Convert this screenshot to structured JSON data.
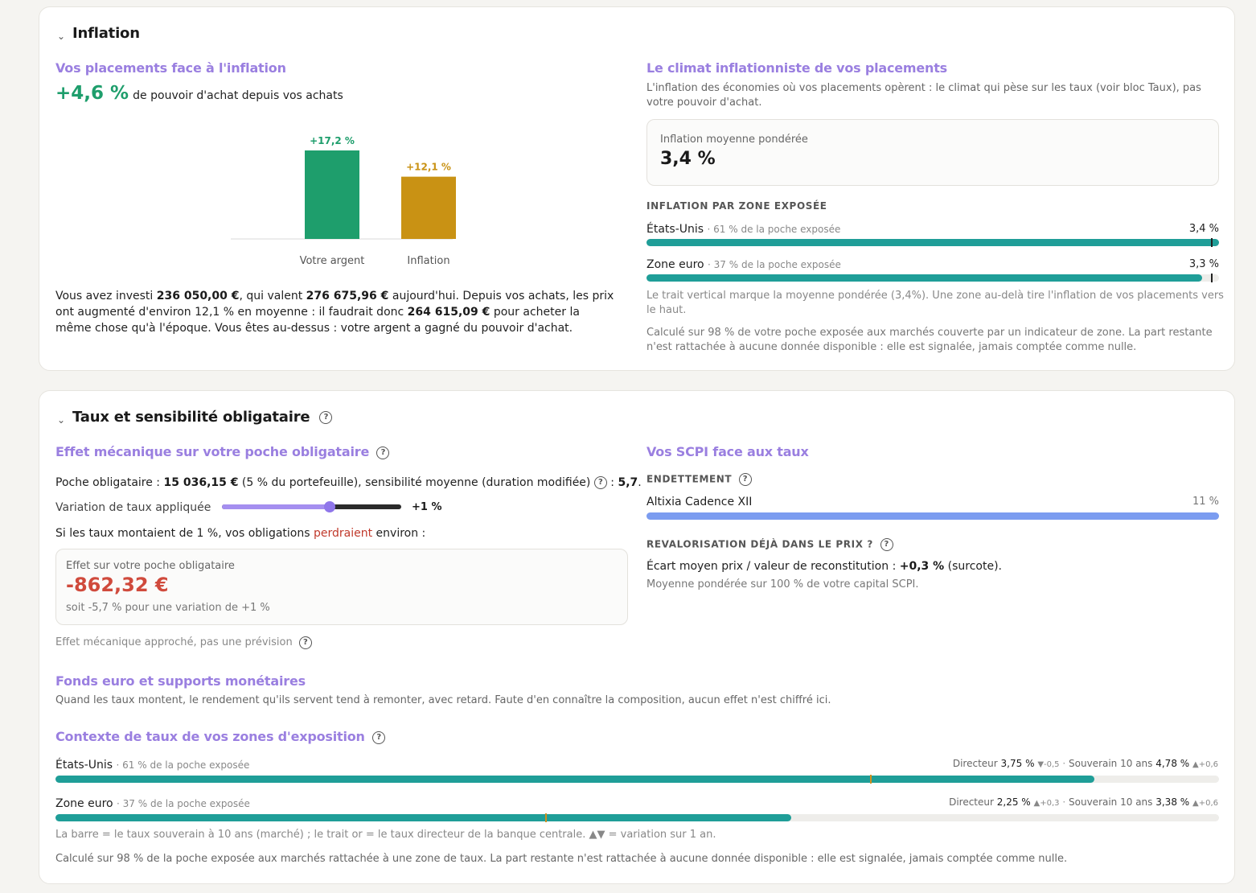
{
  "inflation": {
    "title": "Inflation",
    "left": {
      "subtitle": "Vos placements face à l'inflation",
      "headline_value": "+4,6 %",
      "headline_text": "de pouvoir d'achat depuis vos achats",
      "chart_data": {
        "type": "bar",
        "categories": [
          "Votre argent",
          "Inflation"
        ],
        "values": [
          17.2,
          12.1
        ],
        "value_labels": [
          "+17,2 %",
          "+12,1 %"
        ],
        "colors": [
          "#1e9e6c",
          "#c99214"
        ]
      },
      "paragraph": {
        "p1": "Vous avez investi ",
        "invested": "236 050,00 €",
        "p2": ", qui valent ",
        "current": "276 675,96 €",
        "p3": " aujourd'hui. Depuis vos achats, les prix ont augmenté d'environ 12,1 % en moyenne : il faudrait donc ",
        "needed": "264 615,09 €",
        "p4": " pour acheter la même chose qu'à l'époque. Vous êtes au-dessus : votre argent a gagné du pouvoir d'achat."
      }
    },
    "right": {
      "subtitle": "Le climat inflationniste de vos placements",
      "description": "L'inflation des économies où vos placements opèrent : le climat qui pèse sur les taux (voir bloc Taux), pas votre pouvoir d'achat.",
      "avg_label": "Inflation moyenne pondérée",
      "avg_value": "3,4 %",
      "zones_header": "INFLATION PAR ZONE EXPOSÉE",
      "zones": [
        {
          "name": "États-Unis",
          "share": "· 61 % de la poche exposée",
          "value": "3,4 %",
          "fill_pct": 100,
          "mark_pct": 98.6
        },
        {
          "name": "Zone euro",
          "share": "· 37 % de la poche exposée",
          "value": "3,3 %",
          "fill_pct": 97.1,
          "mark_pct": 98.6
        }
      ],
      "note1": "Le trait vertical marque la moyenne pondérée (3,4%). Une zone au-delà tire l'inflation de vos placements vers le haut.",
      "note2": "Calculé sur 98 % de votre poche exposée aux marchés couverte par un indicateur de zone. La part restante n'est rattachée à aucune donnée disponible : elle est signalée, jamais comptée comme nulle."
    }
  },
  "taux": {
    "title": "Taux et sensibilité obligataire",
    "help": "?",
    "bonds": {
      "subtitle": "Effet mécanique sur votre poche obligataire",
      "line_prefix": "Poche obligataire : ",
      "amount": "15 036,15 €",
      "line_mid": " (5 % du portefeuille), sensibilité moyenne (duration modifiée) ",
      "line_colon": " : ",
      "sensitivity": "5,7",
      "line_end": ".",
      "slider_label": "Variation de taux appliquée",
      "slider_value": "+1 %",
      "slider_level": 0.6,
      "if_prefix": "Si les taux montaient de 1 %, vos obligations ",
      "if_word": "perdraient",
      "if_suffix": " environ :",
      "effect_label": "Effet sur votre poche obligataire",
      "effect_value": "-862,32 €",
      "effect_sub": "soit -5,7 % pour une variation de +1 %",
      "disclaimer": "Effet mécanique approché, pas une prévision"
    },
    "scpi": {
      "subtitle": "Vos SCPI face aux taux",
      "debt_header": "ENDETTEMENT",
      "fund_name": "Altixia Cadence XII",
      "fund_value": "11 %",
      "fund_level": 1.0,
      "reval_header": "REVALORISATION DÉJÀ DANS LE PRIX ?",
      "gap_prefix": "Écart moyen prix / valeur de reconstitution : ",
      "gap_value": "+0,3 %",
      "gap_suffix": " (surcote).",
      "gap_note": "Moyenne pondérée sur 100 % de votre capital SCPI."
    },
    "funds": {
      "subtitle": "Fonds euro et supports monétaires",
      "text": "Quand les taux montent, le rendement qu'ils servent tend à remonter, avec retard. Faute d'en connaître la composition, aucun effet n'est chiffré ici."
    },
    "context": {
      "subtitle": "Contexte de taux de vos zones d'exposition",
      "zones": [
        {
          "name": "États-Unis",
          "share": "· 61 % de la poche exposée",
          "dir_label": "Directeur",
          "dir_value": "3,75 %",
          "dir_arrow": "▼",
          "dir_change": "-0,5",
          "sov_label": "Souverain 10 ans",
          "sov_value": "4,78 %",
          "sov_arrow": "▲",
          "sov_change": "+0,6",
          "fill_pct": 89.3,
          "mark_pct": 70.0
        },
        {
          "name": "Zone euro",
          "share": "· 37 % de la poche exposée",
          "dir_label": "Directeur",
          "dir_value": "2,25 %",
          "dir_arrow": "▲",
          "dir_change": "+0,3",
          "sov_label": "Souverain 10 ans",
          "sov_value": "3,38 %",
          "sov_arrow": "▲",
          "sov_change": "+0,6",
          "fill_pct": 63.2,
          "mark_pct": 42.1
        }
      ],
      "legend": "La barre = le taux souverain à 10 ans (marché) ; le trait or = le taux directeur de la banque centrale. ▲▼ = variation sur 1 an.",
      "footnote": "Calculé sur 98 % de la poche exposée aux marchés rattachée à une zone de taux. La part restante n'est rattachée à aucune donnée disponible : elle est signalée, jamais comptée comme nulle."
    }
  }
}
